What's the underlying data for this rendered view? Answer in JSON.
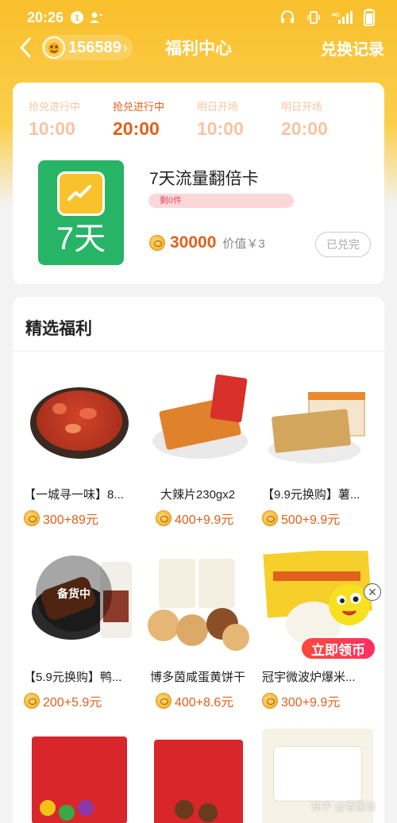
{
  "status_bar": {
    "time": "20:26",
    "notif_badge": "1"
  },
  "nav": {
    "coin_balance": "156589",
    "title": "福利中心",
    "right_link": "兑换记录"
  },
  "schedule": [
    {
      "label": "抢兑进行中",
      "time": "10:00",
      "state": "past"
    },
    {
      "label": "抢兑进行中",
      "time": "20:00",
      "state": "active"
    },
    {
      "label": "明日开场",
      "time": "10:00",
      "state": "upcoming"
    },
    {
      "label": "明日开场",
      "time": "20:00",
      "state": "upcoming"
    }
  ],
  "featured": {
    "tile_label": "7天",
    "name": "7天流量翻倍卡",
    "stock": "剩0件",
    "points": "30000",
    "worth": "价值￥3",
    "button": "已兑完"
  },
  "section": {
    "title": "精选福利"
  },
  "products": [
    {
      "name": "【一城寻一味】8...",
      "price": "300+89元"
    },
    {
      "name": "大辣片230gx2",
      "price": "400+9.9元"
    },
    {
      "name": "【9.9元换购】薯...",
      "price": "500+9.9元"
    },
    {
      "name": "【5.9元换购】鸭...",
      "price": "200+5.9元",
      "badge": "备货中"
    },
    {
      "name": "博多茵咸蛋黄饼干",
      "price": "400+8.6元"
    },
    {
      "name": "冠宇微波炉爆米...",
      "price": "300+9.9元"
    }
  ],
  "float_ad": {
    "cta": "立即领币"
  },
  "watermark": "知乎 @香蕉哥",
  "colors": {
    "brand_yellow": "#f9bf2d",
    "accent_orange": "#e0611c",
    "tile_green": "#27b466"
  }
}
